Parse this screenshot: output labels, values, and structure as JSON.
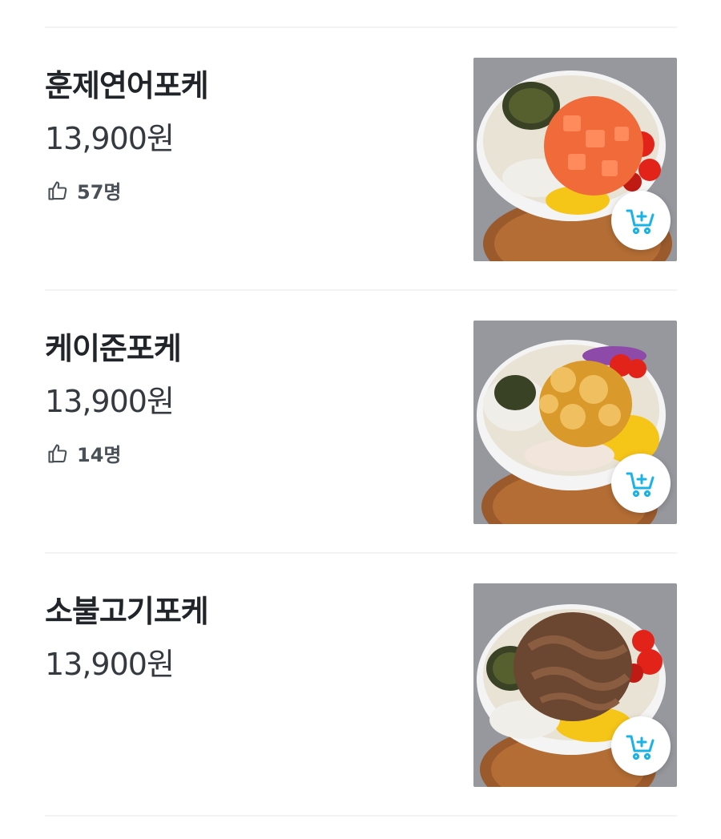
{
  "menu": {
    "items": [
      {
        "name": "훈제연어포케",
        "price": "13,900원",
        "likes": "57명",
        "topping_color": "#f06a3a",
        "topping_highlight": "#ff8a5c"
      },
      {
        "name": "케이준포케",
        "price": "13,900원",
        "likes": "14명",
        "topping_color": "#d99a2b",
        "topping_highlight": "#f0c060"
      },
      {
        "name": "소불고기포케",
        "price": "13,900원",
        "likes": "",
        "topping_color": "#6b4630",
        "topping_highlight": "#8a5c40"
      }
    ]
  },
  "icons": {
    "like": "thumbs-up-icon",
    "cart": "add-to-cart-icon"
  },
  "colors": {
    "cart_accent": "#1ab3e8",
    "divider": "#f1f3f5"
  }
}
